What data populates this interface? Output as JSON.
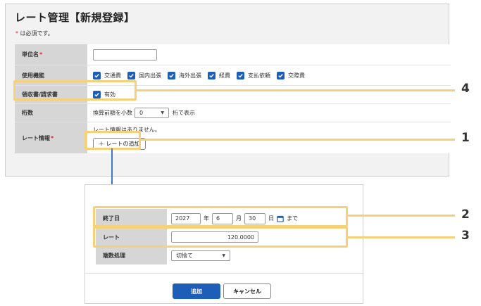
{
  "page": {
    "title": "レート管理【新規登録】",
    "required_note_star": "*",
    "required_note": " は必須です。"
  },
  "form": {
    "unit_name": {
      "label": "単位名",
      "star": "*",
      "value": ""
    },
    "functions": {
      "label": "使用機能",
      "options": [
        "交通費",
        "国内出張",
        "海外出張",
        "経費",
        "支払依頼",
        "交際費"
      ]
    },
    "receipt": {
      "label": "領収書/請求書",
      "option": "有効"
    },
    "digits": {
      "label": "桁数",
      "prefix": "換算前額を小数",
      "selected": "0",
      "suffix": "桁で表示"
    },
    "rate_info": {
      "label": "レート情報",
      "star": "*",
      "empty_text": "レート情報はありません。",
      "add_button": "＋ レートの追加"
    }
  },
  "dialog": {
    "end_date": {
      "label": "終了日",
      "year": "2027",
      "year_unit": "年",
      "month": "6",
      "month_unit": "月",
      "day": "30",
      "day_unit": "日",
      "until": "まで"
    },
    "rate": {
      "label": "レート",
      "value": "120.0000"
    },
    "rounding": {
      "label": "端数処理",
      "selected": "切捨て"
    },
    "add_button": "追加",
    "cancel_button": "キャンセル"
  },
  "callouts": [
    "1",
    "2",
    "3",
    "4"
  ],
  "colors": {
    "primary": "#1d5fb8",
    "highlight": "#f5d27a",
    "required": "#dd2233",
    "connector": "#3b78c9"
  }
}
